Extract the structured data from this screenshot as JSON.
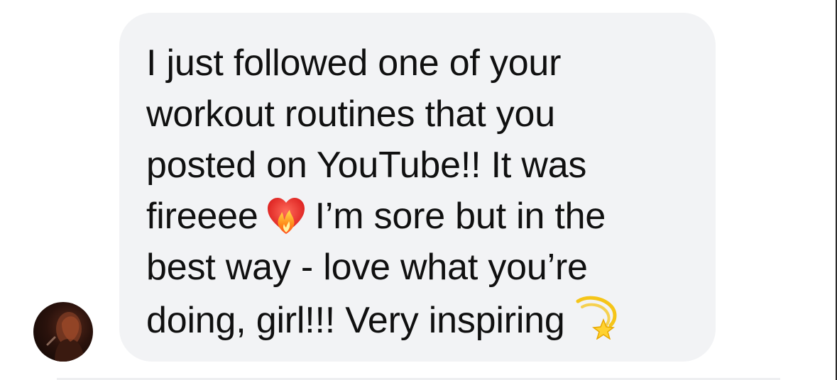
{
  "message": {
    "lines": [
      "I just followed one of your",
      "workout routines that you",
      "posted on YouTube!! It was",
      "fireeee",
      "I’m sore but in the",
      "best way - love what you’re",
      "doing, girl!!! Very inspiring"
    ],
    "emojis": {
      "heart_on_fire": "heart-on-fire-icon",
      "dizzy": "dizzy-star-icon"
    }
  },
  "sender": {
    "avatar_icon": "profile-photo"
  },
  "colors": {
    "bubble": "#f2f3f5",
    "text": "#101010",
    "background": "#ffffff"
  }
}
